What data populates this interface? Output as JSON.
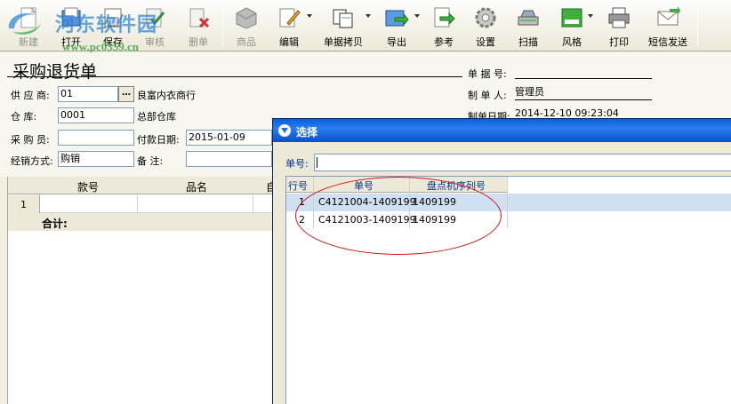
{
  "toolbar": {
    "buttons": [
      {
        "label": "新建",
        "icon": "new-icon",
        "enabled": false
      },
      {
        "label": "打开",
        "icon": "open-icon",
        "enabled": true
      },
      {
        "label": "保存",
        "icon": "save-icon",
        "enabled": true
      },
      {
        "label": "审核",
        "icon": "audit-icon",
        "enabled": false
      },
      {
        "label": "删单",
        "icon": "delete-icon",
        "enabled": false
      },
      {
        "label": "商品",
        "icon": "goods-icon",
        "enabled": false
      },
      {
        "label": "编辑",
        "icon": "edit-icon",
        "enabled": true
      },
      {
        "label": "单据拷贝",
        "icon": "copy-doc-icon",
        "enabled": true
      },
      {
        "label": "导出",
        "icon": "export-icon",
        "enabled": true
      },
      {
        "label": "参考",
        "icon": "reference-icon",
        "enabled": true
      },
      {
        "label": "设置",
        "icon": "settings-gear-icon",
        "enabled": true
      },
      {
        "label": "扫描",
        "icon": "scanner-icon",
        "enabled": true
      },
      {
        "label": "风格",
        "icon": "style-icon",
        "enabled": true
      },
      {
        "label": "打印",
        "icon": "printer-icon",
        "enabled": true
      },
      {
        "label": "短信发送",
        "icon": "sms-envelope-icon",
        "enabled": true
      }
    ]
  },
  "watermark": {
    "title": "河东软件园",
    "url": "www.pc0359.cn"
  },
  "form": {
    "doc_title": "采购退货单",
    "supplier_label": "供 应 商:",
    "supplier_code": "01",
    "supplier_name": "良富内衣商行",
    "warehouse_label": "仓    库:",
    "warehouse_code": "0001",
    "warehouse_name": "总部仓库",
    "buyer_label": "采 购 员:",
    "buyer_value": "",
    "pay_date_label": "付款日期:",
    "pay_date_value": "2015-01-09",
    "sales_mode_label": "经销方式:",
    "sales_mode_value": "购销",
    "remark_label": "备    注:",
    "remark_value": "",
    "doc_no_label": "单 据 号:",
    "doc_no_value": "",
    "maker_label": "制 单 人:",
    "maker_value": "管理员",
    "make_date_label": "制单日期:",
    "make_date_value": "2014-12-10 09:23:04"
  },
  "grid": {
    "columns": [
      "款号",
      "品名",
      "自"
    ],
    "row_number": "1",
    "total_label": "合计:"
  },
  "dialog": {
    "title": "选择",
    "doc_no_label": "单号:",
    "doc_no_value": "",
    "columns": [
      "行号",
      "单号",
      "盘点机序列号"
    ],
    "rows": [
      {
        "row": "1",
        "doc_no": "C4121004-1409199",
        "serial": "1409199"
      },
      {
        "row": "2",
        "doc_no": "C4121003-1409199",
        "serial": "1409199"
      }
    ]
  },
  "colors": {
    "title_bar": "#0a5fd8",
    "selected_row": "#cfe0f3",
    "annotation": "#d01818"
  }
}
